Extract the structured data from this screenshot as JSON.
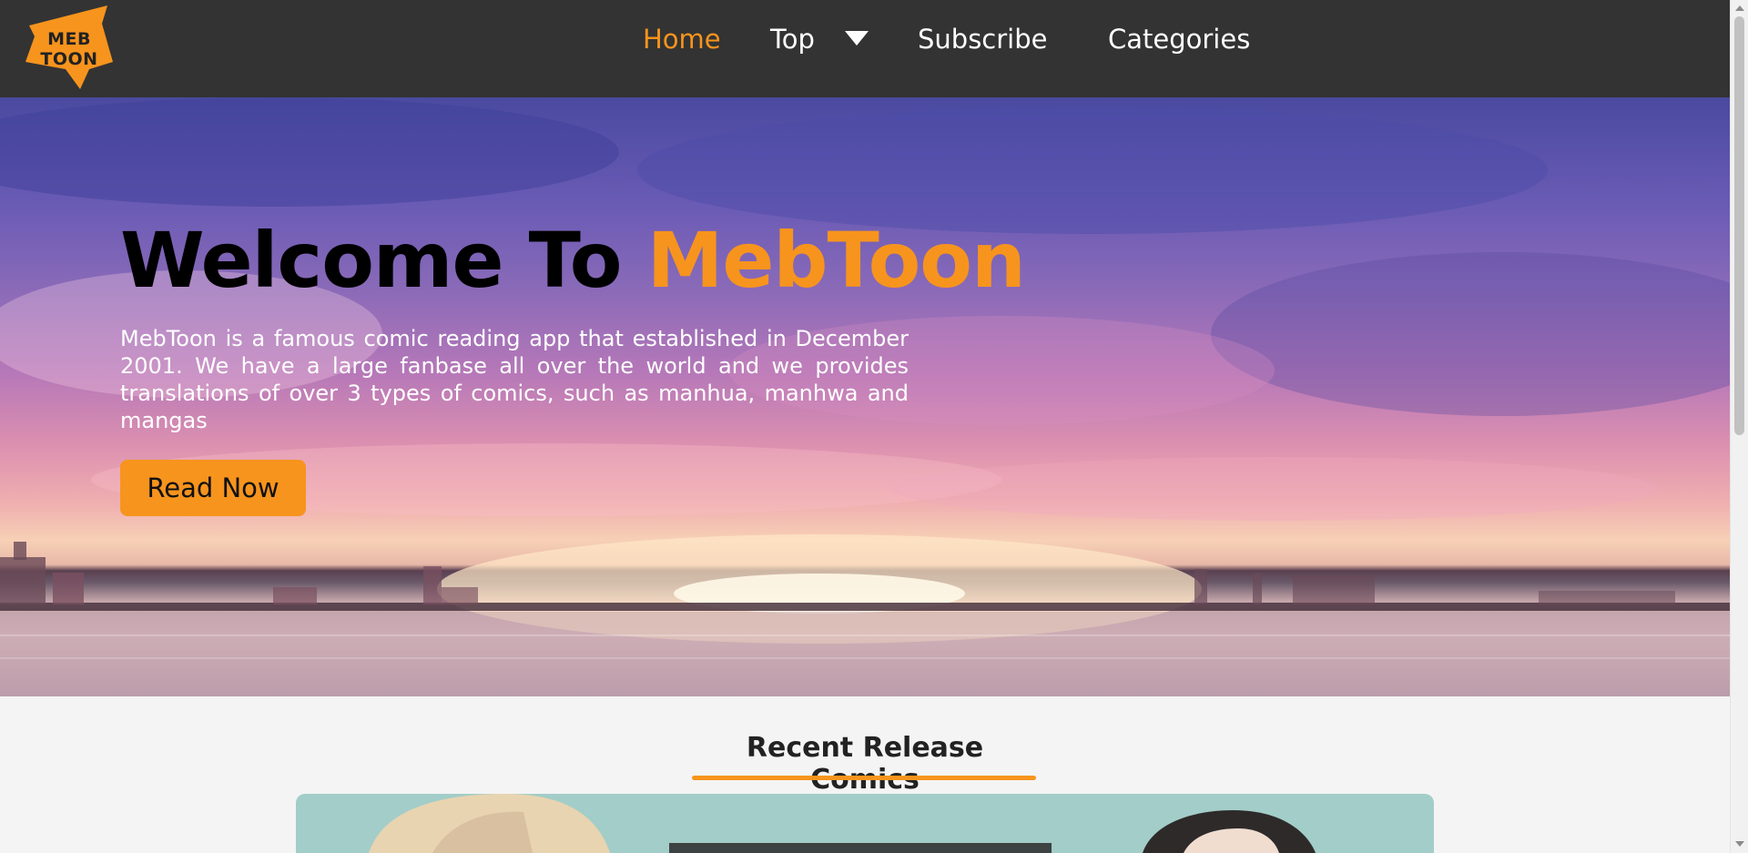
{
  "logo": {
    "line1": "MEB",
    "line2": "TOON",
    "icon": "mebtoon-logo-icon"
  },
  "nav": {
    "home": "Home",
    "top": "Top",
    "top_caret_icon": "caret-down-icon",
    "subscribe": "Subscribe",
    "categories": "Categories"
  },
  "hero": {
    "title_prefix": "Welcome To ",
    "title_brand": "MebToon",
    "description": "MebToon is a famous comic reading app that established in December 2001. We have a large fanbase all over the world and we provides translations of over 3 types of comics, such as manhua, manhwa and mangas",
    "cta": "Read Now"
  },
  "recent": {
    "title": "Recent Release Comics"
  },
  "colors": {
    "accent": "#f7941d",
    "navbar": "#333333",
    "page_bg": "#f4f4f4",
    "banner_bg": "#a3cdc8"
  }
}
